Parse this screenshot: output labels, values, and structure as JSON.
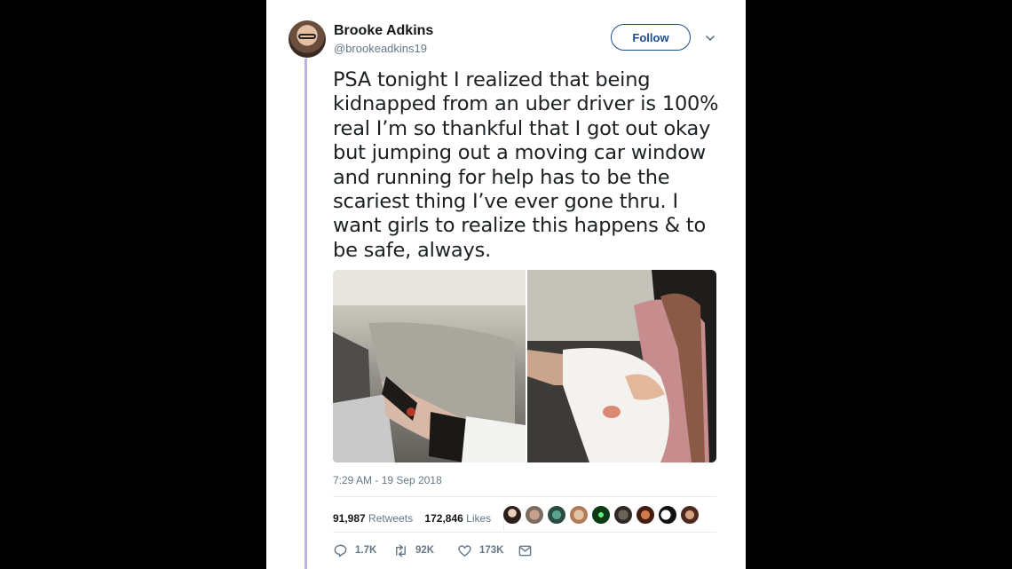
{
  "user": {
    "name": "Brooke Adkins",
    "handle": "@brookeadkins19",
    "follow_label": "Follow"
  },
  "tweet": {
    "text": "PSA tonight I realized that being kidnapped from an uber driver is 100% real I’m so thankful that I got out okay but jumping out a moving car window and running for help has to be the scariest thing I’ve ever gone thru. I want girls to realize this happens & to be safe, always.",
    "timestamp": "7:29 AM - 19 Sep 2018"
  },
  "stats": {
    "retweets_count": "91,987",
    "retweets_label": "Retweets",
    "likes_count": "172,846",
    "likes_label": "Likes"
  },
  "actions": {
    "reply_count": "1.7K",
    "retweet_count": "92K",
    "like_count": "173K"
  },
  "icons": {
    "reply": "reply-icon",
    "retweet": "retweet-icon",
    "like": "heart-icon",
    "message": "envelope-icon",
    "more": "chevron-down-icon"
  },
  "colors": {
    "follow_accent": "#1d4c8c",
    "thread_line": "#b9b3e4",
    "muted_text": "#657786"
  }
}
